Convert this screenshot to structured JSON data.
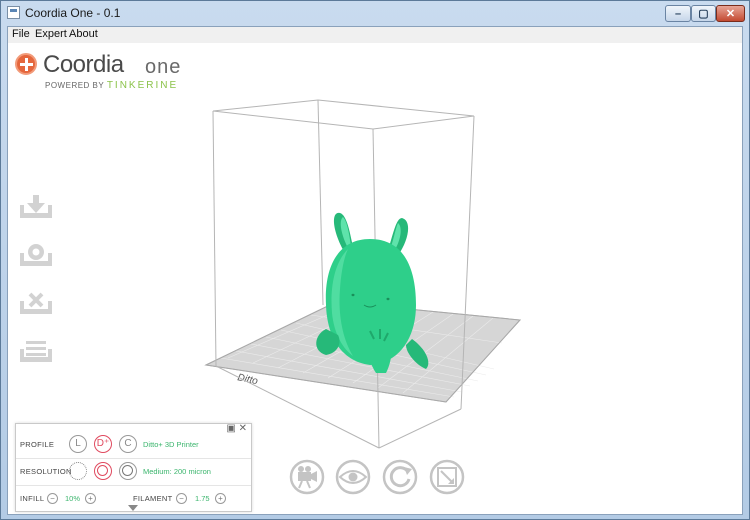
{
  "window": {
    "title": "Coordia One - 0.1",
    "controls": {
      "minimize": "–",
      "maximize": "▢",
      "close": "✕"
    }
  },
  "menu": [
    "File",
    "Expert",
    "About"
  ],
  "logo": {
    "word": "Coordia",
    "suffix": "one",
    "powered": "POWERED BY",
    "brand": "TINKERINE"
  },
  "side_tools": [
    "import-icon",
    "settings-icon",
    "clear-icon",
    "layers-icon"
  ],
  "print_bed_label": "Ditto",
  "panel": {
    "profile": {
      "label": "PROFILE",
      "options": [
        "L",
        "D⁺",
        "C"
      ],
      "selected": 1,
      "value": "Ditto+ 3D Printer"
    },
    "resolution": {
      "label": "RESOLUTION",
      "selected": 1,
      "value": "Medium: 200 micron"
    },
    "infill": {
      "label": "INFILL",
      "value": "10%",
      "minus": "−",
      "plus": "+"
    },
    "filament": {
      "label": "FILAMENT",
      "value": "1.75",
      "minus": "−",
      "plus": "+"
    }
  },
  "view_tools": [
    "camera-icon",
    "view-eye-icon",
    "rotate-icon",
    "scale-icon"
  ],
  "colors": {
    "model": "#2ecf8a",
    "accent_red": "#e04a5f",
    "value_green": "#3bb56d",
    "brand_green": "#8bc34a"
  }
}
